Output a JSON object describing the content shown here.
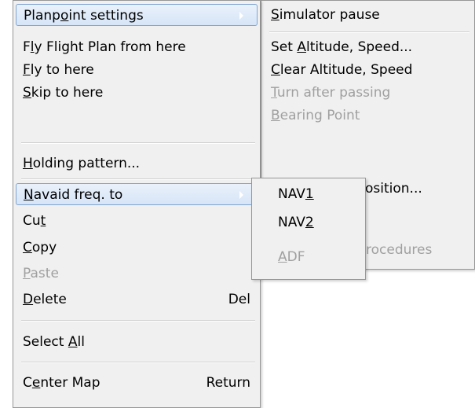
{
  "main_menu": {
    "items": [
      {
        "pre": "Planp",
        "ul": "o",
        "post": "int settings",
        "accel": "",
        "disabled": false
      },
      {
        "pre": "F",
        "ul": "l",
        "post": "y Flight Plan from here",
        "accel": "",
        "disabled": false
      },
      {
        "pre": "",
        "ul": "F",
        "post": "ly to here",
        "accel": "",
        "disabled": false
      },
      {
        "pre": "",
        "ul": "S",
        "post": "kip to here",
        "accel": "",
        "disabled": false
      },
      {
        "pre": "",
        "ul": "H",
        "post": "olding pattern...",
        "accel": "",
        "disabled": false
      },
      {
        "pre": "",
        "ul": "N",
        "post": "avaid freq. to",
        "accel": "",
        "disabled": false
      },
      {
        "pre": "Cu",
        "ul": "t",
        "post": "",
        "accel": "",
        "disabled": false
      },
      {
        "pre": "",
        "ul": "C",
        "post": "opy",
        "accel": "",
        "disabled": false
      },
      {
        "pre": "",
        "ul": "P",
        "post": "aste",
        "accel": "",
        "disabled": true
      },
      {
        "pre": "",
        "ul": "D",
        "post": "elete",
        "accel": "Del",
        "disabled": false
      },
      {
        "pre": "Select ",
        "ul": "A",
        "post": "ll",
        "accel": "",
        "disabled": false
      },
      {
        "pre": "C",
        "ul": "e",
        "post": "nter Map",
        "accel": "Return",
        "disabled": false
      }
    ]
  },
  "planpoint_submenu": {
    "items": [
      {
        "pre": "",
        "ul": "S",
        "post": "imulator pause",
        "disabled": false
      },
      {
        "pre": "Set ",
        "ul": "A",
        "post": "ltitude, Speed...",
        "disabled": false
      },
      {
        "pre": "",
        "ul": "C",
        "post": "lear Altitude, Speed",
        "disabled": false
      },
      {
        "pre": "",
        "ul": "T",
        "post": "urn after passing",
        "disabled": true
      },
      {
        "pre": "",
        "ul": "B",
        "post": "earing Point",
        "disabled": true
      }
    ],
    "partial_position": "osition...",
    "partial_procedures": "rocedures"
  },
  "navaid_submenu": {
    "items": [
      {
        "pre": "NAV",
        "ul": "1",
        "post": "",
        "disabled": false
      },
      {
        "pre": "NAV",
        "ul": "2",
        "post": "",
        "disabled": false
      },
      {
        "pre": "",
        "ul": "A",
        "post": "DF",
        "disabled": true
      }
    ]
  }
}
